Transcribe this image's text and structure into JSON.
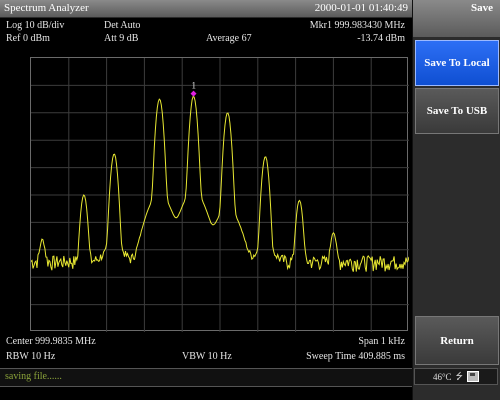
{
  "titlebar": {
    "app_name": "Spectrum Analyzer",
    "datetime": "2000-01-01 01:40:49"
  },
  "softkeys": {
    "menu_title": "Save",
    "items": [
      {
        "label": "Save To Local",
        "active": true
      },
      {
        "label": "Save To USB",
        "active": false
      },
      {
        "label": "",
        "active": false
      },
      {
        "label": "",
        "active": false
      },
      {
        "label": "",
        "active": false
      },
      {
        "label": "Return",
        "active": false
      }
    ]
  },
  "readouts": {
    "scale": "Log 10 dB/div",
    "detector": "Det Auto",
    "marker": "Mkr1 999.983430 MHz",
    "ref_level": "Ref 0 dBm",
    "attenuation": "Att 9 dB",
    "average": "Average 67",
    "marker_level": "-13.74 dBm",
    "center": "Center 999.9835 MHz",
    "span": "Span 1 kHz",
    "rbw": "RBW 10 Hz",
    "vbw": "VBW 10 Hz",
    "sweep_time": "Sweep Time 409.885 ms"
  },
  "marker_label": "1",
  "status": {
    "message": "saving file......",
    "temperature": "46°C",
    "usb_icon": "usb-icon",
    "disk_icon": "disk-icon"
  },
  "colors": {
    "trace": "#e8e832",
    "marker": "#e020e0",
    "active_key": "#1f5fe6"
  },
  "chart_data": {
    "type": "line",
    "x_units": "MHz",
    "y_units": "dBm",
    "xlim": [
      999.983,
      999.984
    ],
    "ylim": [
      -100,
      0
    ],
    "grid": true,
    "peaks": [
      {
        "x": 999.98303,
        "y": -67
      },
      {
        "x": 999.98314,
        "y": -50
      },
      {
        "x": 999.98322,
        "y": -35
      },
      {
        "x": 999.98334,
        "y": -15
      },
      {
        "x": 999.98343,
        "y": -14
      },
      {
        "x": 999.98352,
        "y": -20
      },
      {
        "x": 999.98362,
        "y": -36
      },
      {
        "x": 999.98371,
        "y": -52
      },
      {
        "x": 999.9838,
        "y": -64
      }
    ],
    "noise_floor": -75,
    "marker": {
      "x": 999.98343,
      "y": -13.74
    }
  }
}
